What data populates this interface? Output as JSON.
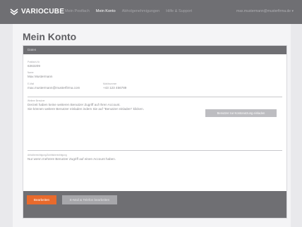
{
  "header": {
    "brand": "VARIOCUBE",
    "nav": [
      {
        "label": "Mein Postfach",
        "active": false
      },
      {
        "label": "Mein Konto",
        "active": true
      },
      {
        "label": "Abholgenehmigungen",
        "active": false
      },
      {
        "label": "Hilfe & Support",
        "active": false
      }
    ],
    "user_email": "max.mustermann@musterfirma.de"
  },
  "page": {
    "title": "Mein Konto"
  },
  "card": {
    "header": "Daten",
    "postfach_label": "Postfach-Nr.",
    "postfach_value": "6363209",
    "name_label": "Name",
    "name_value": "Max Mustermann",
    "email_label": "E-Mail",
    "email_value": "max.mustermann@musterfirma.com",
    "phone_label": "Mobilnummer",
    "phone_value": "+43 123 456789",
    "users_label": "Weitere Benutzer",
    "users_line1": "Derzeit haben keine weiteren Benutzer Zugriff auf Ihren Account.",
    "users_line2": "Sie können weitere Benutzer einladen indem Sie auf \"Benutzer einladen\" klicken.",
    "invite_button": "Benutzer zur Kontonutzung einladen",
    "pickup_label": "Abholberechtigung/Zutrittsberechtigung",
    "pickup_value": "Nur wenn mehrere Benutzer Zugriff auf einen Account haben."
  },
  "footer": {
    "edit_button": "Bearbeiten",
    "edit_email_button": "E-Mail & Telefon bearbeiten"
  },
  "colors": {
    "topbar": "#6f6f73",
    "accent": "#e96a2c",
    "background": "#e9e9ec"
  }
}
